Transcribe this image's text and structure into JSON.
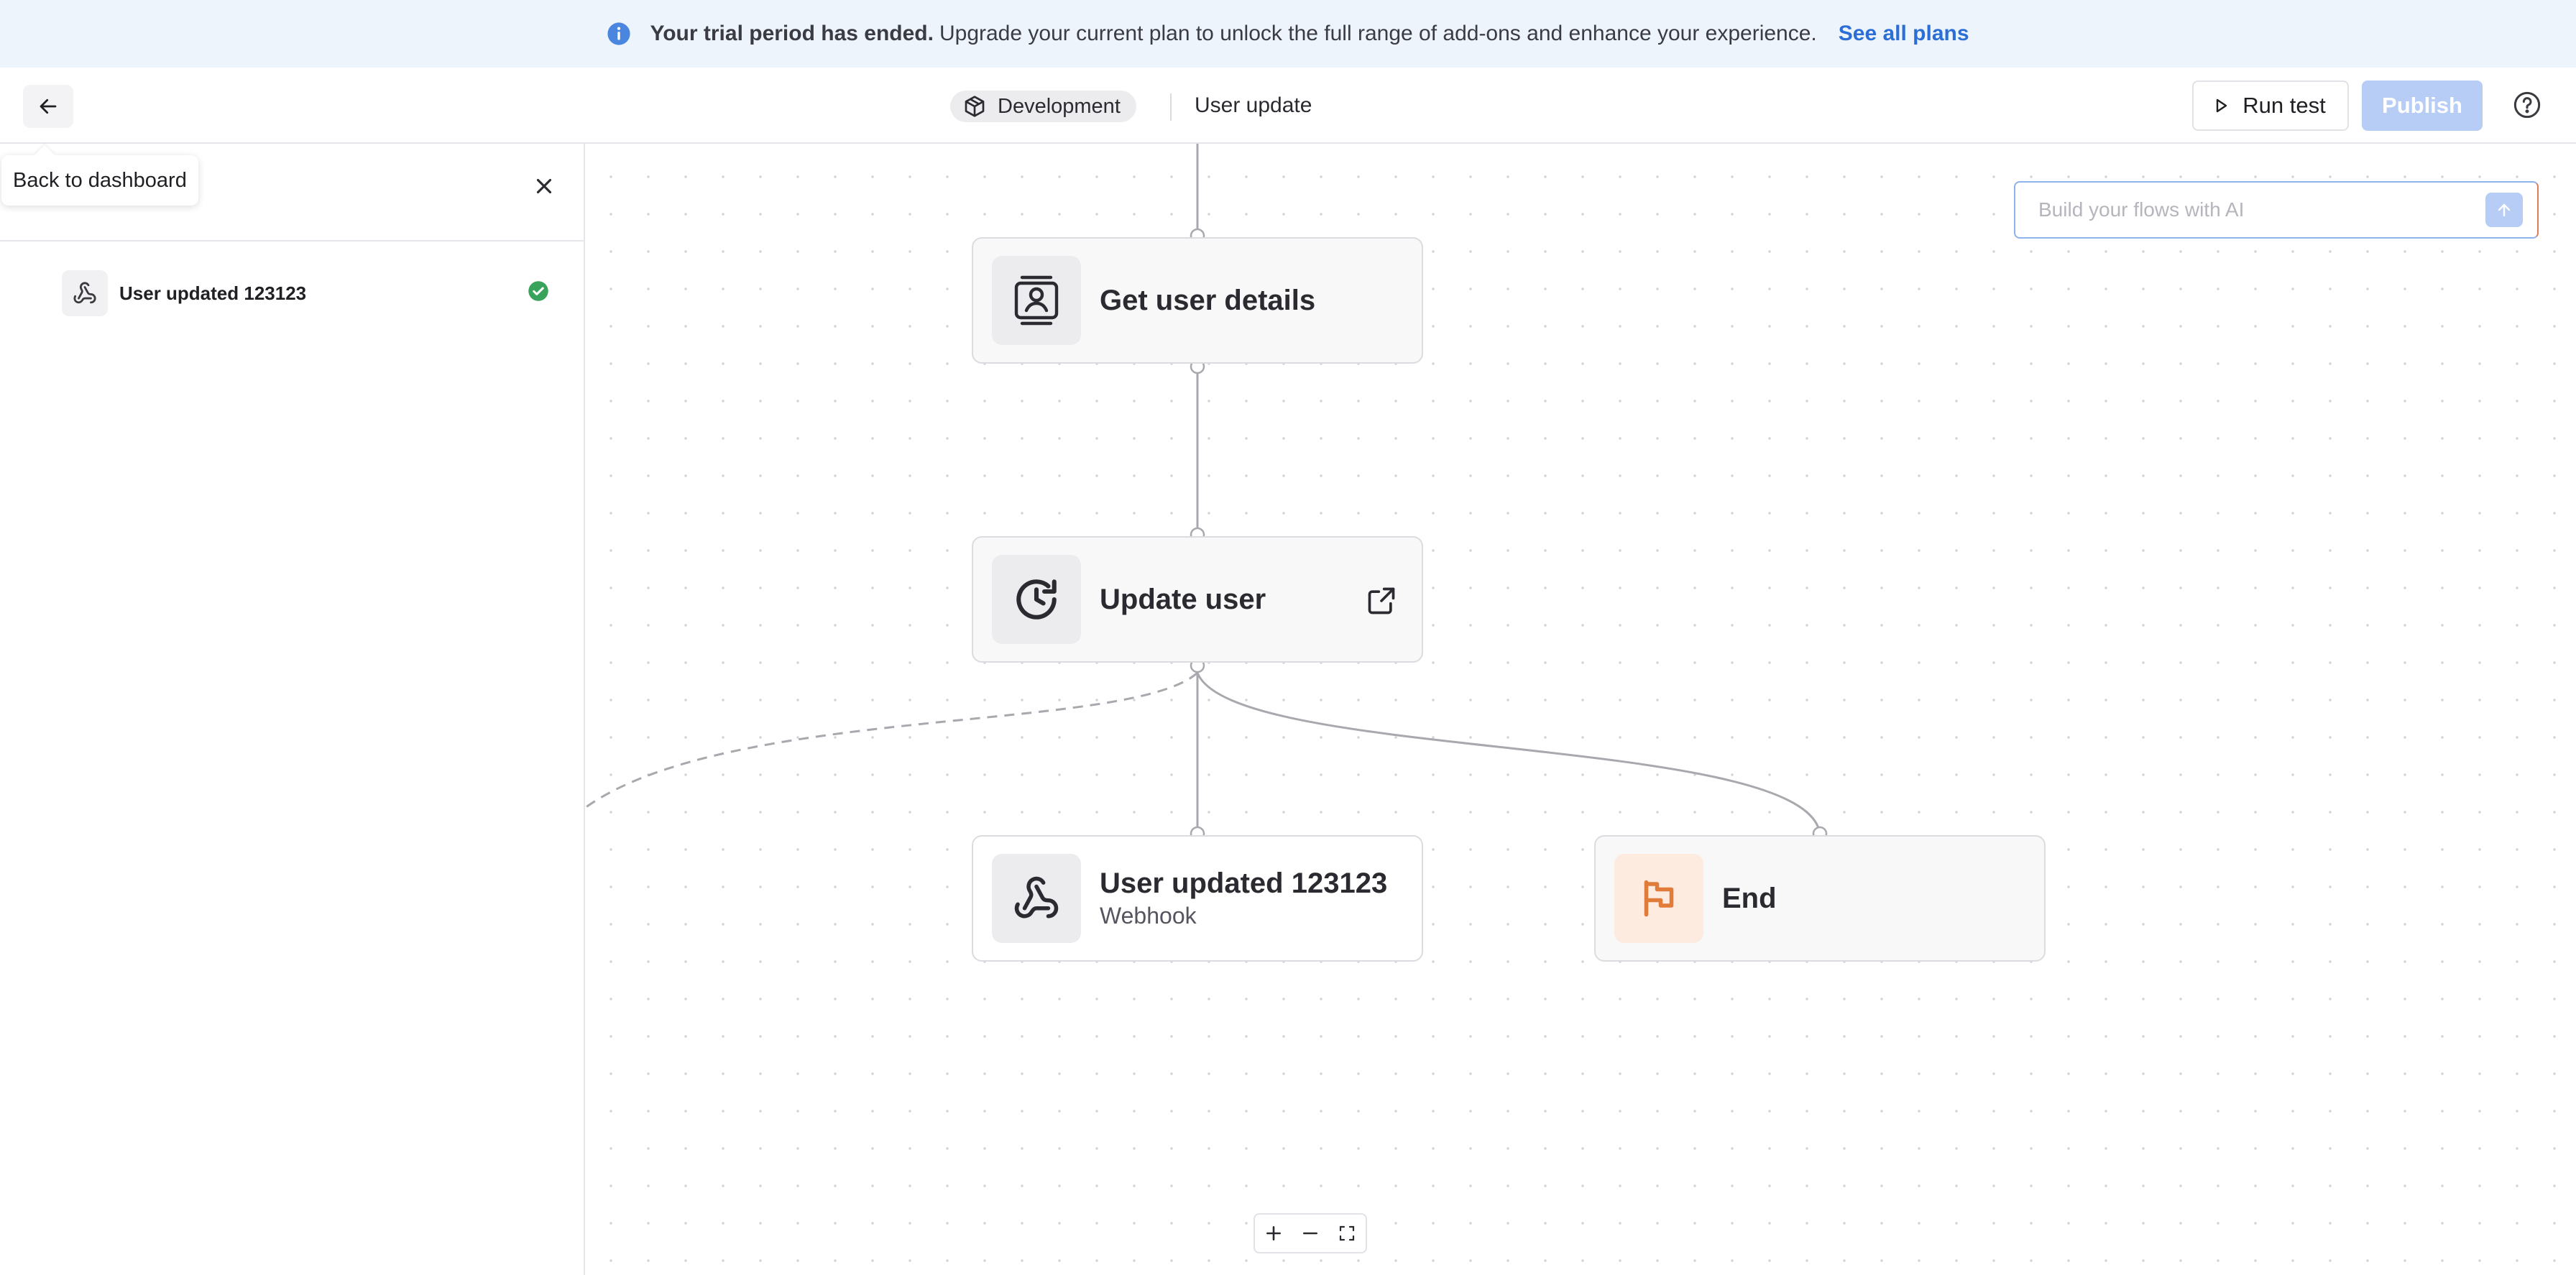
{
  "banner": {
    "icon": "info-icon",
    "title": "Your trial period has ended.",
    "message": "Upgrade your current plan to unlock the full range of add-ons and enhance your experience.",
    "link": "See all plans"
  },
  "header": {
    "environment": "Development",
    "flow_name": "User update",
    "run_test_label": "Run test",
    "publish_label": "Publish"
  },
  "tooltip": {
    "text": "Back to dashboard"
  },
  "panel": {
    "items": [
      {
        "label": "User updated 123123",
        "status": "success"
      }
    ]
  },
  "canvas": {
    "nodes": [
      {
        "title": "Get user details",
        "icon": "contact-card-icon"
      },
      {
        "title": "Update user",
        "icon": "clock-rotate-icon"
      },
      {
        "title": "User updated 123123",
        "subtitle": "Webhook",
        "icon": "webhook-icon"
      },
      {
        "title": "End",
        "icon": "flag-icon"
      }
    ],
    "ai_placeholder": "Build your flows with AI"
  },
  "colors": {
    "accent": "#2b6fd6",
    "publish_disabled": "#b7cdf5",
    "success": "#3aa35b",
    "end_orange": "#e07b39"
  }
}
